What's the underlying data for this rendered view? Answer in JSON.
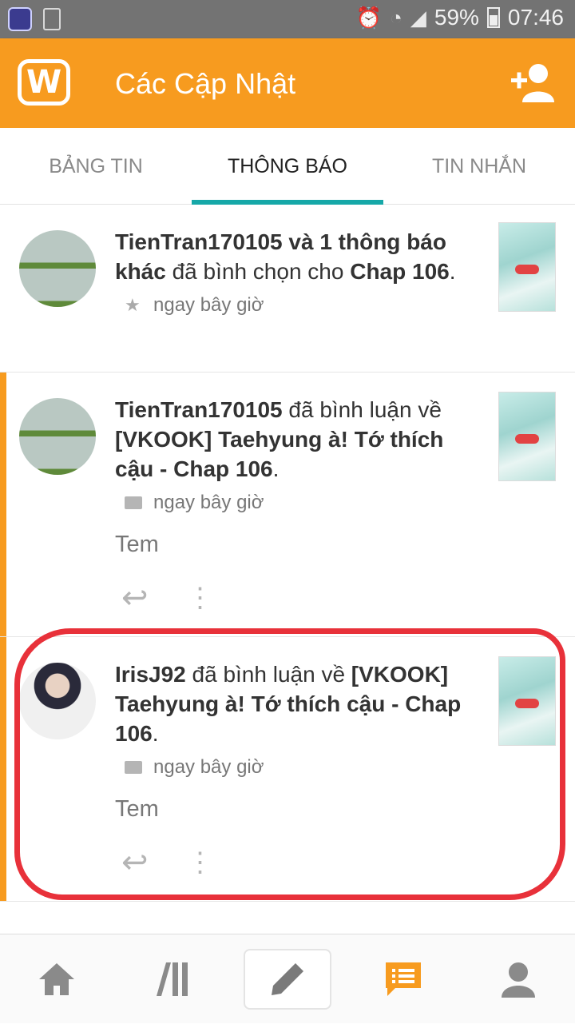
{
  "status_bar": {
    "battery": "59%",
    "time": "07:46"
  },
  "app_bar": {
    "title": "Các Cập Nhật",
    "logo": "W"
  },
  "tabs": [
    {
      "label": "BẢNG TIN"
    },
    {
      "label": "THÔNG BÁO",
      "active": true
    },
    {
      "label": "TIN NHẮN"
    }
  ],
  "notifications": [
    {
      "user": "TienTran170105 và 1 thông báo khác",
      "action": " đã bình chọn cho ",
      "story": "Chap 106",
      "end": ".",
      "time": "ngay bây giờ",
      "icon": "star-icon"
    },
    {
      "user": "TienTran170105",
      "action": " đã bình luận về ",
      "story": "[VKOOK] Taehyung à! Tớ thích cậu - Chap 106",
      "end": ".",
      "time": "ngay bây giờ",
      "icon": "comment-icon",
      "comment": "Tem"
    },
    {
      "user": "IrisJ92",
      "action": " đã bình luận về ",
      "story": "[VKOOK] Taehyung à! Tớ thích cậu - Chap 106",
      "end": ".",
      "time": "ngay bây giờ",
      "icon": "comment-icon",
      "comment": "Tem"
    }
  ],
  "colors": {
    "accent": "#f79b1f",
    "tab_indicator": "#16a8a8",
    "highlight": "#e8313a"
  }
}
